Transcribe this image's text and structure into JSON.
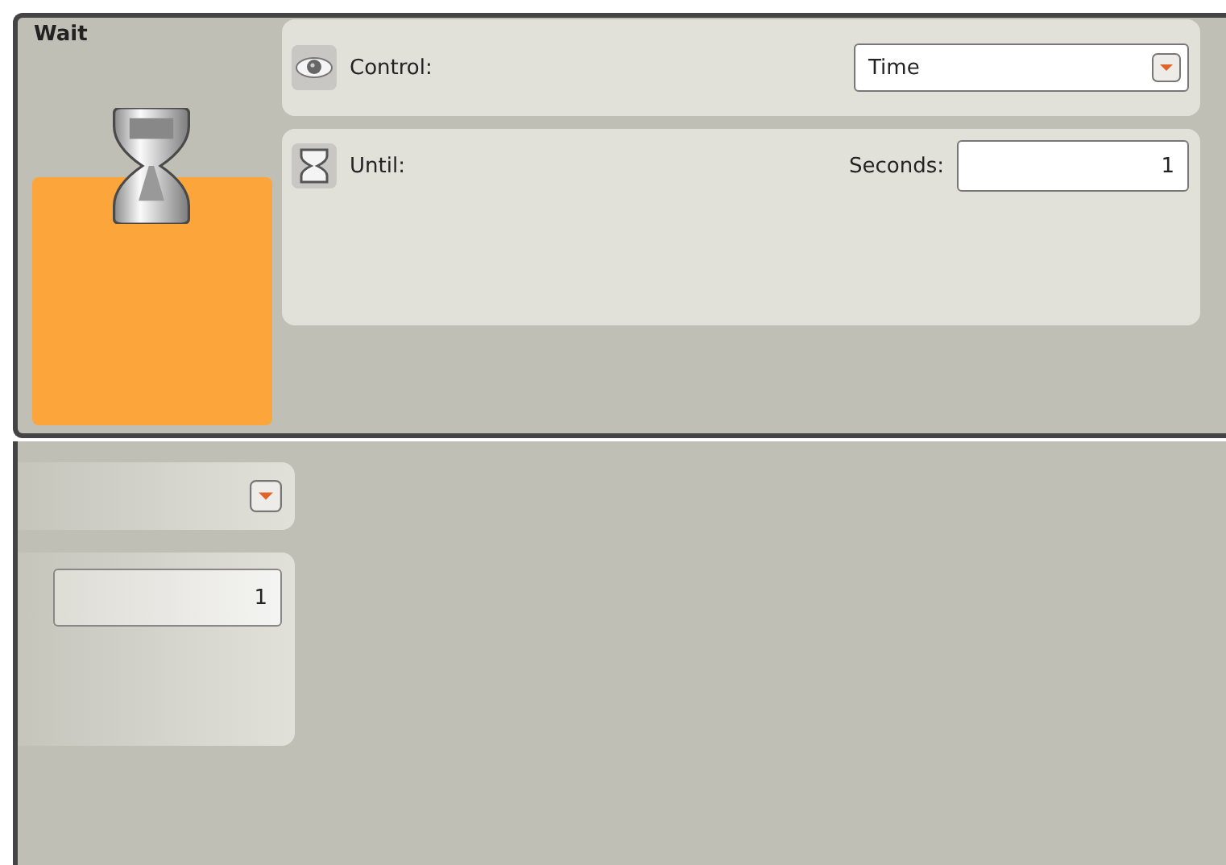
{
  "block": {
    "title": "Wait"
  },
  "control": {
    "label": "Control:",
    "value": "Time"
  },
  "until": {
    "label": "Until:",
    "field_label": "Seconds:",
    "value": "1"
  },
  "faded_panel": {
    "field_value": "1"
  }
}
